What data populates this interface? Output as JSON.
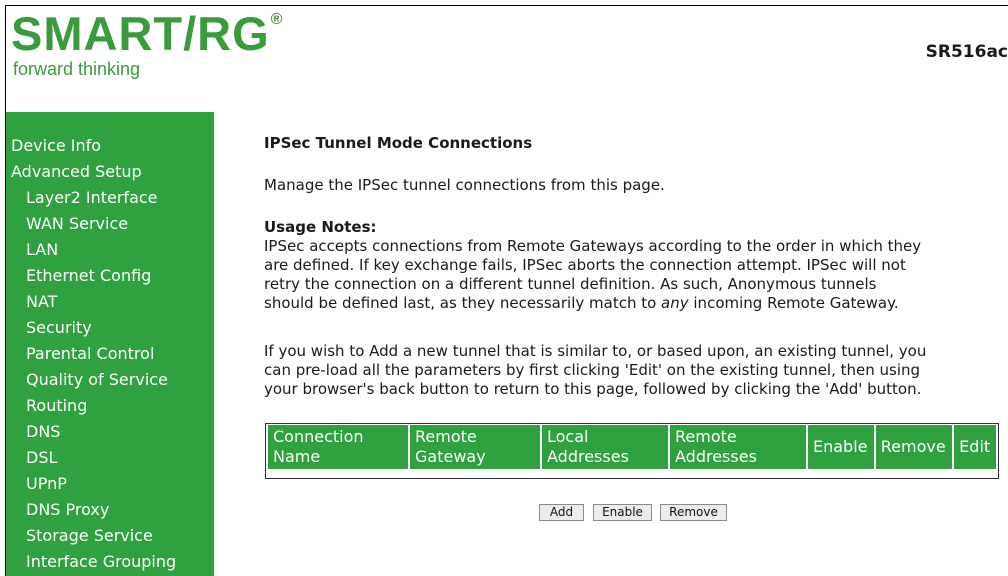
{
  "header": {
    "logo_text": "SMART/RG",
    "logo_reg": "®",
    "tagline": "forward thinking",
    "model": "SR516ac"
  },
  "sidebar": {
    "items": [
      {
        "label": "Device Info",
        "level": 0
      },
      {
        "label": "Advanced Setup",
        "level": 0
      },
      {
        "label": "Layer2 Interface",
        "level": 1
      },
      {
        "label": "WAN Service",
        "level": 1
      },
      {
        "label": "LAN",
        "level": 1
      },
      {
        "label": "Ethernet Config",
        "level": 1
      },
      {
        "label": "NAT",
        "level": 1
      },
      {
        "label": "Security",
        "level": 1
      },
      {
        "label": "Parental Control",
        "level": 1
      },
      {
        "label": "Quality of Service",
        "level": 1
      },
      {
        "label": "Routing",
        "level": 1
      },
      {
        "label": "DNS",
        "level": 1
      },
      {
        "label": "DSL",
        "level": 1
      },
      {
        "label": "UPnP",
        "level": 1
      },
      {
        "label": "DNS Proxy",
        "level": 1
      },
      {
        "label": "Storage Service",
        "level": 1
      },
      {
        "label": "Interface Grouping",
        "level": 1
      }
    ]
  },
  "main": {
    "title": "IPSec Tunnel Mode Connections",
    "manage_text": "Manage the IPSec tunnel connections from this page.",
    "usage_title": "Usage Notes:",
    "usage_lines": [
      "IPSec accepts connections from Remote Gateways according to the order in which they",
      "are defined. If key exchange fails, IPSec aborts the connection attempt. IPSec will not",
      "retry the connection on a different tunnel definition. As such, Anonymous tunnels",
      "should be defined last, as they necessarily match to ",
      "any",
      " incoming Remote Gateway."
    ],
    "add_lines": [
      "If you wish to Add a new tunnel that is similar to, or based upon, an existing tunnel, you",
      "can pre-load all the parameters by first clicking 'Edit' on the existing tunnel, then using",
      "your browser's back button to return to this page, followed by clicking the 'Add' button."
    ]
  },
  "table": {
    "headers": [
      [
        "Connection",
        "Name"
      ],
      [
        "Remote",
        "Gateway"
      ],
      [
        "Local",
        "Addresses"
      ],
      [
        "Remote",
        "Addresses"
      ],
      [
        "Enable"
      ],
      [
        "Remove"
      ],
      [
        "Edit"
      ]
    ],
    "header_color": "#2fa13f"
  },
  "buttons": {
    "add": "Add",
    "enable": "Enable",
    "remove": "Remove"
  },
  "colors": {
    "brand_green": "#3a9b3c",
    "sidebar_green": "#2fa13f"
  }
}
